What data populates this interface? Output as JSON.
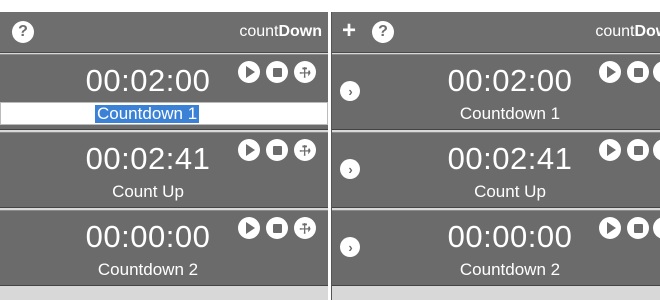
{
  "app": {
    "title_prefix": "count",
    "title_bold": "Down",
    "help_glyph": "?",
    "add_glyph": "+"
  },
  "timers": [
    {
      "time": "00:02:00",
      "label": "Countdown 1"
    },
    {
      "time": "00:02:41",
      "label": "Count Up"
    },
    {
      "time": "00:00:00",
      "label": "Countdown 2"
    }
  ],
  "icons": {
    "help": "help-icon",
    "add": "plus-icon",
    "play": "play-icon",
    "stop": "stop-icon",
    "settings": "wrench-icon",
    "open": "chevron-right-icon"
  },
  "colors": {
    "header": "#6e6e6e",
    "row": "#6b6b6b",
    "selection": "#3b82d6",
    "text": "#ffffff"
  }
}
